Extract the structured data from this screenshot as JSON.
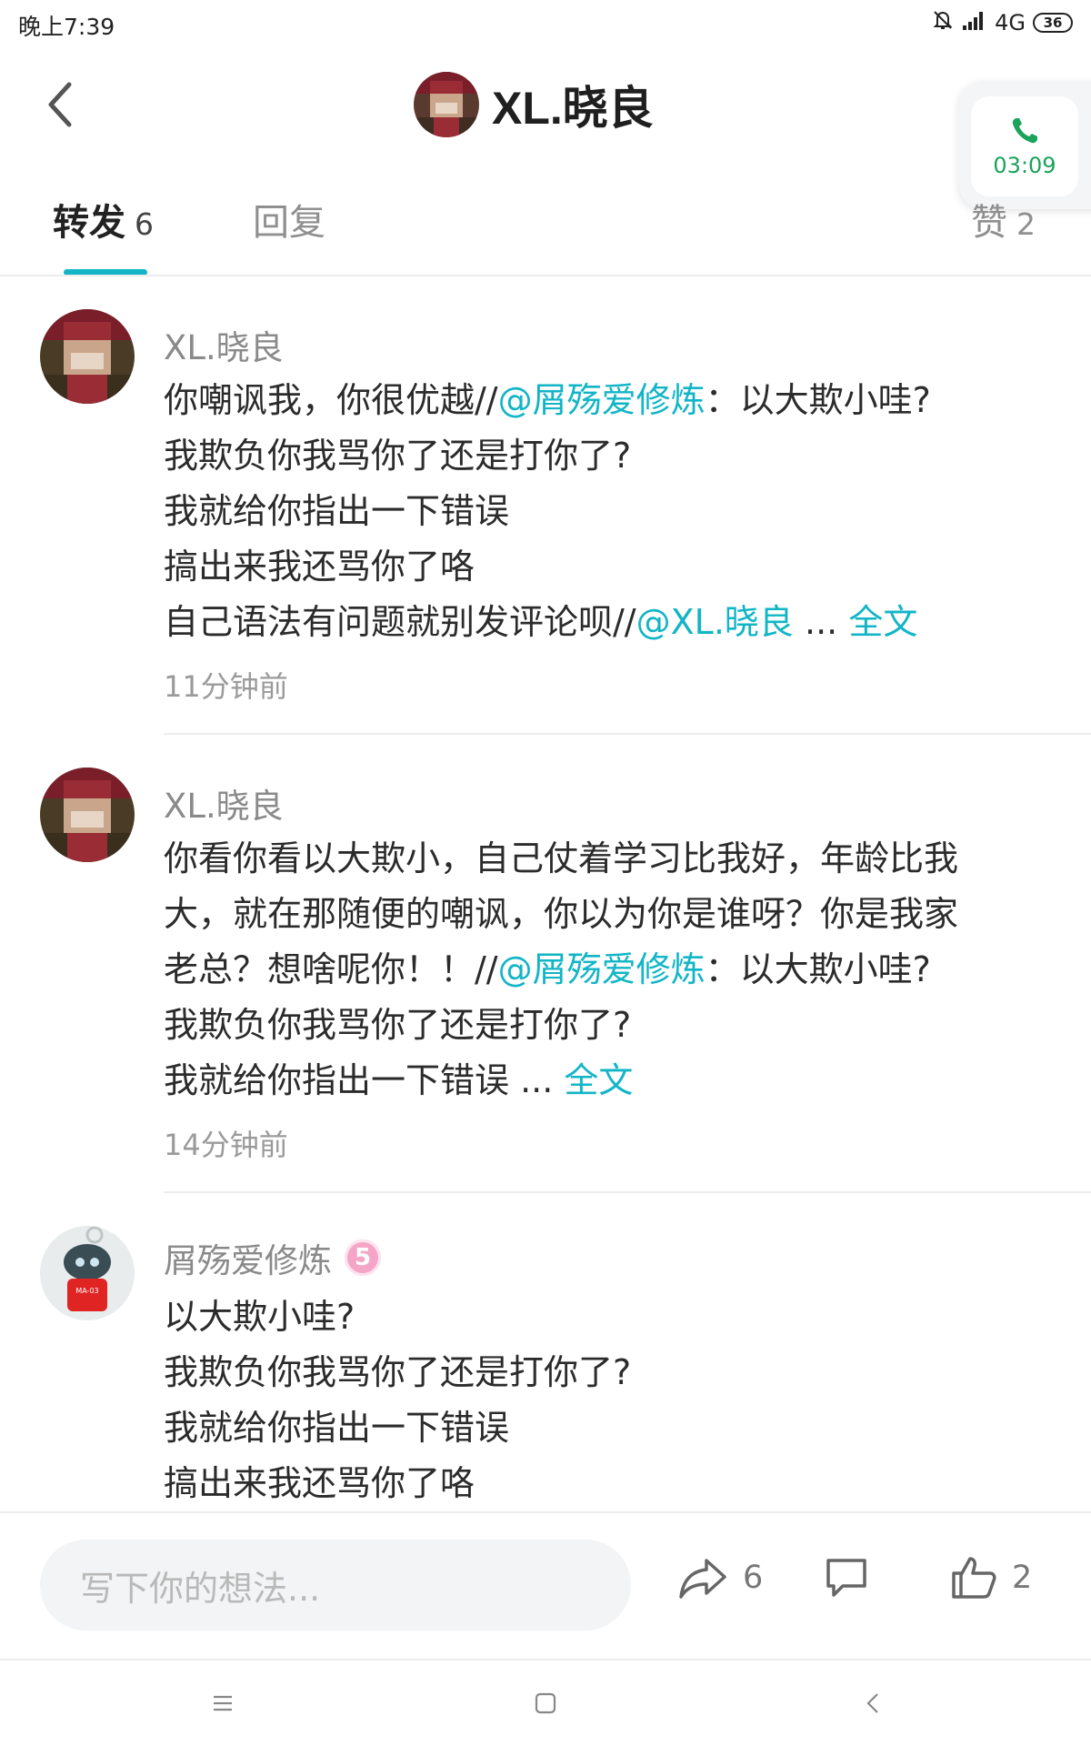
{
  "status_bar": {
    "time": "晚上7:39",
    "network": "4G",
    "battery": "36"
  },
  "header": {
    "title": "XL.晓良"
  },
  "call_widget": {
    "duration": "03:09",
    "color": "#1aa35a"
  },
  "tabs": {
    "forward": {
      "label": "转发",
      "count": "6"
    },
    "reply": {
      "label": "回复"
    },
    "like": {
      "label": "赞",
      "count": "2"
    },
    "active_color": "#12b5c6"
  },
  "comments": [
    {
      "user": "XL.晓良",
      "lines": [
        {
          "pre": "你嘲讽我，你很优越//",
          "mention": "@屑殇爱修炼",
          "post": "：以大欺小哇?"
        },
        {
          "text": "我欺负你我骂你了还是打你了?"
        },
        {
          "text": "我就给你指出一下错误"
        },
        {
          "text": "搞出来我还骂你了咯"
        },
        {
          "pre": "自己语法有问题就别发评论呗//",
          "mention": "@XL.晓良",
          "post": " ...",
          "more": "全文"
        }
      ],
      "time": "11分钟前"
    },
    {
      "user": "XL.晓良",
      "lines": [
        {
          "text": "你看你看以大欺小，自己仗着学习比我好，年龄比我"
        },
        {
          "text": "大，就在那随便的嘲讽，你以为你是谁呀？你是我家"
        },
        {
          "pre": "老总？想啥呢你！！//",
          "mention": "@屑殇爱修炼",
          "post": "：以大欺小哇?"
        },
        {
          "text": "我欺负你我骂你了还是打你了?"
        },
        {
          "pre": "我就给你指出一下错误 ...",
          "more": "全文"
        }
      ],
      "time": "14分钟前"
    },
    {
      "user": "屑殇爱修炼",
      "level": "5",
      "lines": [
        {
          "text": "以大欺小哇?"
        },
        {
          "text": "我欺负你我骂你了还是打你了?"
        },
        {
          "text": "我就给你指出一下错误"
        },
        {
          "text": "搞出来我还骂你了咯"
        }
      ],
      "avatar_label": "MA-03"
    }
  ],
  "bottom_bar": {
    "input_placeholder": "写下你的想法...",
    "forward_count": "6",
    "like_count": "2"
  }
}
